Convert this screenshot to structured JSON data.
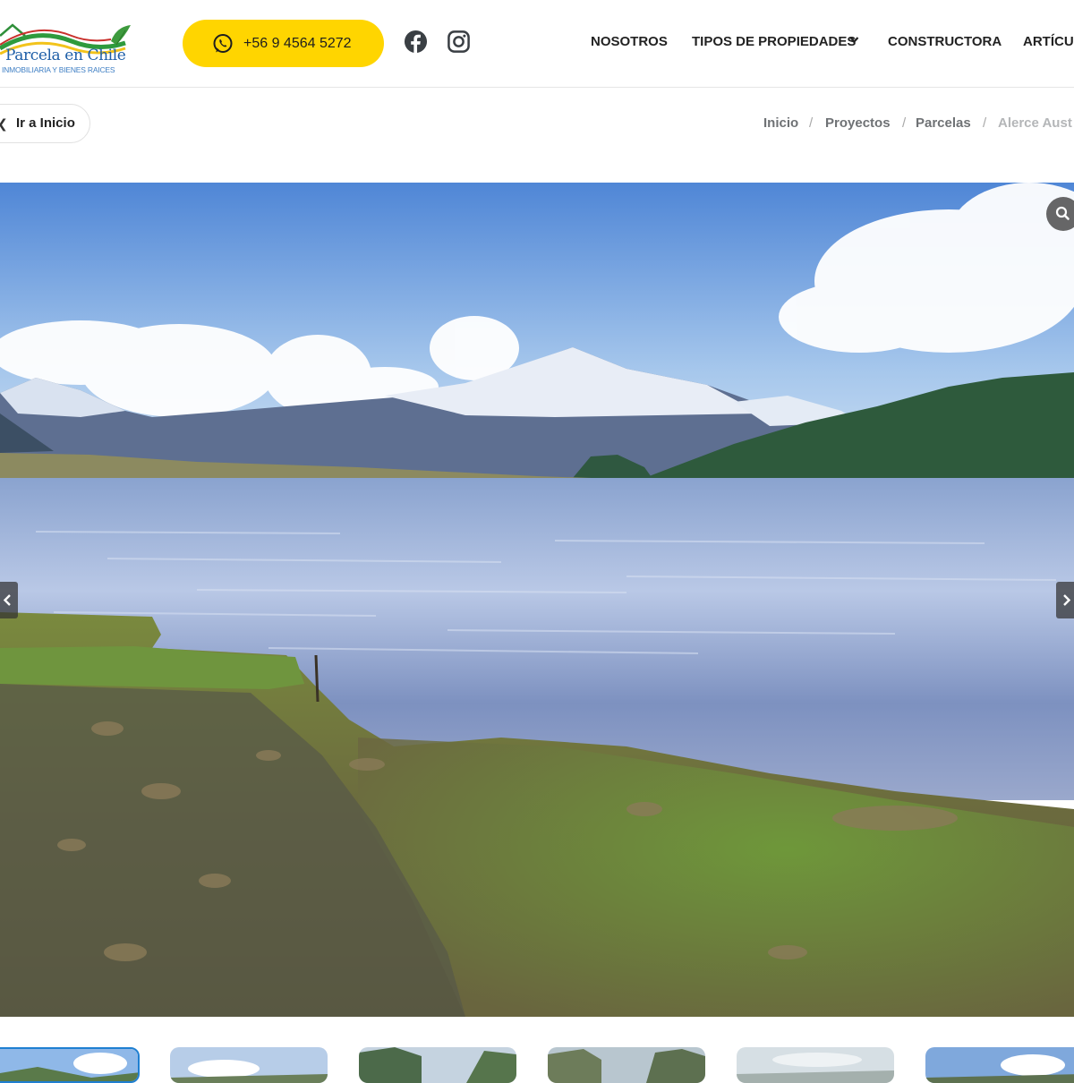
{
  "header": {
    "logo": {
      "name": "Parcela en Chile",
      "tagline": "INMOBILIARIA Y BIENES RAICES"
    },
    "phone_button": {
      "icon": "whatsapp-icon",
      "number": "+56 9 4564 5272"
    },
    "social": [
      {
        "icon": "facebook-icon"
      },
      {
        "icon": "instagram-icon"
      }
    ],
    "nav": [
      {
        "label": "NOSOTROS"
      },
      {
        "label": "TIPOS DE PROPIEDADES",
        "icon": "chevron-down-icon"
      },
      {
        "label": "CONSTRUCTORA"
      },
      {
        "label": "ARTÍCUL"
      }
    ],
    "colors": {
      "accent": "#ffd500",
      "text": "#222222"
    }
  },
  "subheader": {
    "back_button": {
      "icon": "chevron-left-icon",
      "label": "Ir a Inicio"
    },
    "breadcrumb": [
      {
        "label": "Inicio"
      },
      {
        "label": "Proyectos"
      },
      {
        "label": "Parcelas"
      },
      {
        "label": "Alerce Aust"
      }
    ],
    "breadcrumb_separator": "/"
  },
  "gallery": {
    "zoom_icon": "search-icon",
    "prev_icon": "chevron-left-icon",
    "next_icon": "chevron-right-icon",
    "thumbnail_count": 6
  }
}
